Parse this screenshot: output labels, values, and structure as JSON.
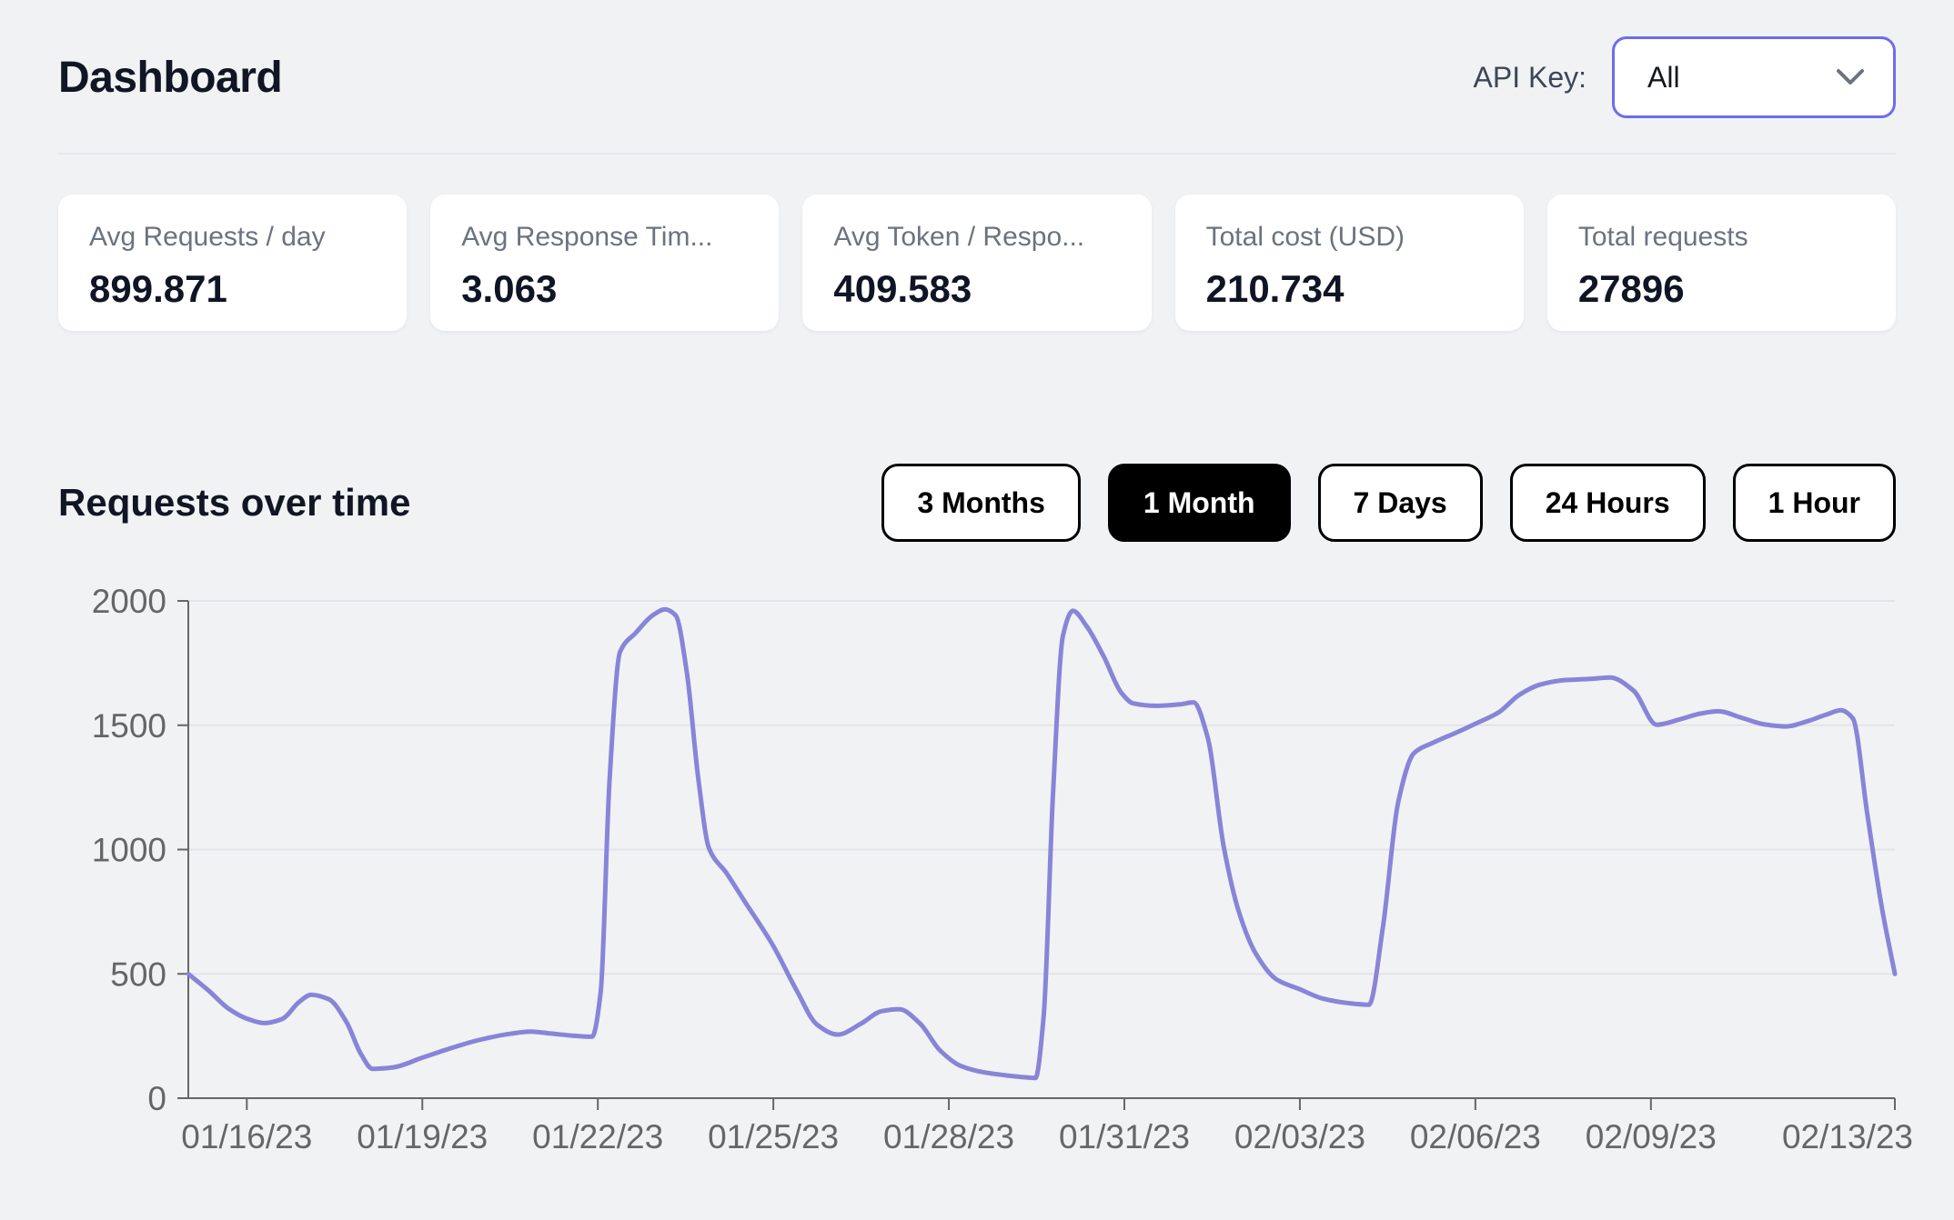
{
  "header": {
    "title": "Dashboard",
    "api_key_label": "API Key:",
    "api_key_value": "All"
  },
  "stats": [
    {
      "label": "Avg Requests / day",
      "value": "899.871"
    },
    {
      "label": "Avg Response Tim...",
      "value": "3.063"
    },
    {
      "label": "Avg Token / Respo...",
      "value": "409.583"
    },
    {
      "label": "Total cost (USD)",
      "value": "210.734"
    },
    {
      "label": "Total requests",
      "value": "27896"
    }
  ],
  "section": {
    "title": "Requests over time",
    "ranges": [
      {
        "label": "3 Months",
        "active": false
      },
      {
        "label": "1 Month",
        "active": true
      },
      {
        "label": "7 Days",
        "active": false
      },
      {
        "label": "24 Hours",
        "active": false
      },
      {
        "label": "1 Hour",
        "active": false
      }
    ]
  },
  "colors": {
    "accent": "#6e6cef",
    "line": "#8884d8",
    "axis": "#666666",
    "grid": "#e3e4e7",
    "active_button_bg": "#000000",
    "page_bg": "#f1f2f4"
  },
  "chart_data": {
    "type": "line",
    "title": "Requests over time",
    "xlabel": "",
    "ylabel": "",
    "legend": "none",
    "grid": "horizontal",
    "xlim": [
      0,
      29.17
    ],
    "ylim": [
      0,
      2000
    ],
    "y_ticks": [
      0,
      500,
      1000,
      1500,
      2000
    ],
    "x_tick_days": [
      1,
      4,
      7,
      10,
      13,
      16,
      19,
      22,
      25,
      29.17
    ],
    "x_tick_labels": [
      "01/16/23",
      "01/19/23",
      "01/22/23",
      "01/25/23",
      "01/28/23",
      "01/31/23",
      "02/03/23",
      "02/06/23",
      "02/09/23",
      "02/13/23"
    ],
    "series_name": "Requests",
    "points": [
      [
        0,
        500
      ],
      [
        0.35,
        432
      ],
      [
        0.7,
        358
      ],
      [
        1.0,
        320
      ],
      [
        1.3,
        302
      ],
      [
        1.6,
        318
      ],
      [
        1.9,
        388
      ],
      [
        2.1,
        416
      ],
      [
        2.4,
        398
      ],
      [
        2.7,
        308
      ],
      [
        2.95,
        178
      ],
      [
        3.15,
        118
      ],
      [
        3.5,
        124
      ],
      [
        4.0,
        163
      ],
      [
        4.5,
        202
      ],
      [
        5.0,
        236
      ],
      [
        5.5,
        259
      ],
      [
        5.85,
        268
      ],
      [
        6.2,
        260
      ],
      [
        6.55,
        252
      ],
      [
        6.9,
        247
      ],
      [
        7.05,
        430
      ],
      [
        7.2,
        1280
      ],
      [
        7.38,
        1795
      ],
      [
        7.65,
        1872
      ],
      [
        7.95,
        1944
      ],
      [
        8.15,
        1966
      ],
      [
        8.33,
        1942
      ],
      [
        8.52,
        1715
      ],
      [
        8.72,
        1280
      ],
      [
        8.9,
        1005
      ],
      [
        9.2,
        905
      ],
      [
        9.5,
        795
      ],
      [
        10.0,
        612
      ],
      [
        10.4,
        432
      ],
      [
        10.75,
        295
      ],
      [
        11.1,
        256
      ],
      [
        11.5,
        300
      ],
      [
        11.85,
        350
      ],
      [
        12.15,
        358
      ],
      [
        12.5,
        302
      ],
      [
        12.85,
        192
      ],
      [
        13.2,
        130
      ],
      [
        13.6,
        104
      ],
      [
        14.0,
        91
      ],
      [
        14.3,
        84
      ],
      [
        14.48,
        81
      ],
      [
        14.62,
        330
      ],
      [
        14.78,
        1220
      ],
      [
        14.95,
        1860
      ],
      [
        15.12,
        1960
      ],
      [
        15.35,
        1900
      ],
      [
        15.65,
        1775
      ],
      [
        15.95,
        1630
      ],
      [
        16.15,
        1588
      ],
      [
        16.55,
        1578
      ],
      [
        16.95,
        1584
      ],
      [
        17.18,
        1592
      ],
      [
        17.42,
        1455
      ],
      [
        17.7,
        1010
      ],
      [
        17.95,
        755
      ],
      [
        18.25,
        580
      ],
      [
        18.6,
        478
      ],
      [
        19.0,
        438
      ],
      [
        19.4,
        400
      ],
      [
        19.8,
        383
      ],
      [
        20.18,
        376
      ],
      [
        20.42,
        690
      ],
      [
        20.68,
        1190
      ],
      [
        20.95,
        1388
      ],
      [
        21.3,
        1432
      ],
      [
        21.7,
        1473
      ],
      [
        22.0,
        1506
      ],
      [
        22.4,
        1552
      ],
      [
        22.75,
        1622
      ],
      [
        23.1,
        1663
      ],
      [
        23.5,
        1681
      ],
      [
        24.0,
        1687
      ],
      [
        24.3,
        1692
      ],
      [
        24.7,
        1640
      ],
      [
        25.1,
        1502
      ],
      [
        25.5,
        1524
      ],
      [
        25.85,
        1547
      ],
      [
        26.15,
        1556
      ],
      [
        26.55,
        1530
      ],
      [
        26.95,
        1503
      ],
      [
        27.3,
        1495
      ],
      [
        27.7,
        1518
      ],
      [
        28.0,
        1543
      ],
      [
        28.25,
        1560
      ],
      [
        28.45,
        1528
      ],
      [
        28.7,
        1140
      ],
      [
        28.95,
        762
      ],
      [
        29.17,
        500
      ]
    ]
  }
}
